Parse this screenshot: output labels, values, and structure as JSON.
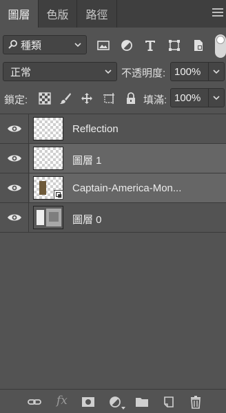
{
  "tabs": [
    {
      "label": "圖層",
      "active": true
    },
    {
      "label": "色版",
      "active": false
    },
    {
      "label": "路徑",
      "active": false
    }
  ],
  "filter": {
    "kind_label": "種類",
    "icons": [
      "image-filter-icon",
      "adjustment-filter-icon",
      "type-filter-icon",
      "shape-filter-icon",
      "smart-object-filter-icon"
    ]
  },
  "blend": {
    "mode": "正常",
    "opacity_label": "不透明度:",
    "opacity_value": "100%"
  },
  "lock": {
    "label": "鎖定:",
    "fill_label": "填滿:",
    "fill_value": "100%"
  },
  "layers": [
    {
      "name": "Reflection",
      "thumb": "transparent",
      "visible": true,
      "highlighted": false
    },
    {
      "name": "圖層 1",
      "thumb": "transparent",
      "visible": true,
      "highlighted": true
    },
    {
      "name": "Captain-America-Mon...",
      "thumb": "smart-object",
      "visible": true,
      "highlighted": true
    },
    {
      "name": "圖層 0",
      "thumb": "photo",
      "visible": true,
      "highlighted": false
    }
  ],
  "bottom_toolbar": {
    "fx_label": "fx"
  },
  "colors": {
    "panel_bg": "#535353",
    "tabbar_bg": "#3f3f3f",
    "highlight_row": "#666666"
  }
}
